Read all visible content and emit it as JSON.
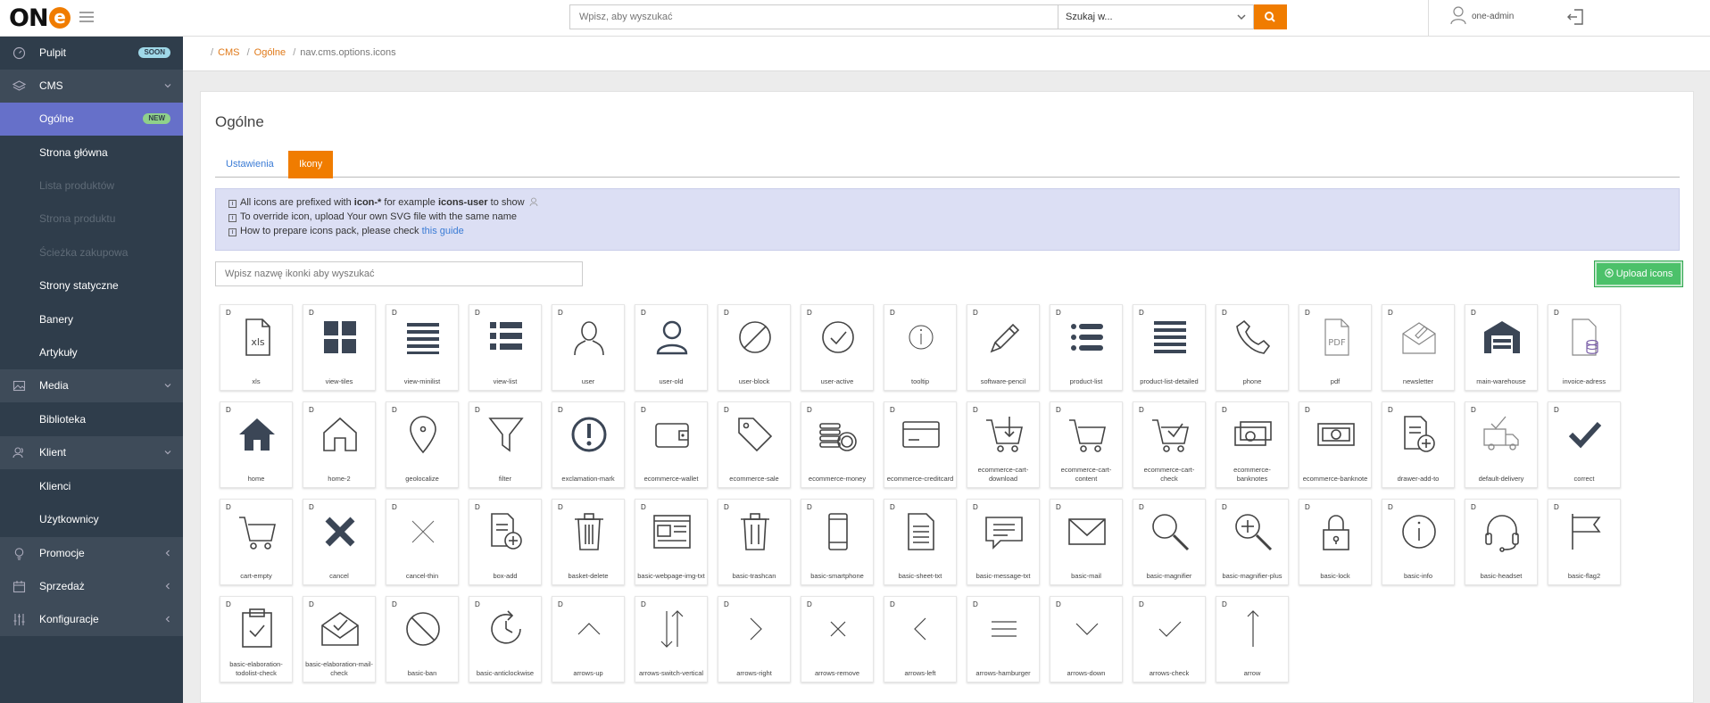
{
  "header": {
    "logo_text": "ON",
    "logo_e": "e",
    "search_placeholder": "Wpisz, aby wyszukać",
    "search_scope": "Szukaj w...",
    "user_name": "one-admin"
  },
  "sidebar": {
    "items": [
      {
        "label": "Pulpit",
        "badge": "SOON"
      },
      {
        "label": "CMS"
      },
      {
        "label": "Ogólne",
        "badge": "NEW"
      },
      {
        "label": "Strona główna"
      },
      {
        "label": "Lista produktów"
      },
      {
        "label": "Strona produktu"
      },
      {
        "label": "Ścieżka zakupowa"
      },
      {
        "label": "Strony statyczne"
      },
      {
        "label": "Banery"
      },
      {
        "label": "Artykuły"
      },
      {
        "label": "Media"
      },
      {
        "label": "Biblioteka"
      },
      {
        "label": "Klient"
      },
      {
        "label": "Klienci"
      },
      {
        "label": "Użytkownicy"
      },
      {
        "label": "Promocje"
      },
      {
        "label": "Sprzedaż"
      },
      {
        "label": "Konfiguracje"
      }
    ]
  },
  "breadcrumb": {
    "sep": "/",
    "items": [
      "CMS",
      "Ogólne",
      "nav.cms.options.icons"
    ]
  },
  "page": {
    "title": "Ogólne",
    "tabs": [
      "Ustawienia",
      "Ikony"
    ],
    "info": {
      "line1_a": "All icons are prefixed with ",
      "line1_b": "icon-*",
      "line1_c": " for example ",
      "line1_d": "icons-user",
      "line1_e": " to show",
      "line2": "To override icon, upload Your own SVG file with the same name",
      "line3_a": "How to prepare icons pack, please check ",
      "line3_link": "this guide",
      "info_glyph": "i"
    },
    "filter_placeholder": "Wpisz nazwę ikonki aby wyszukać",
    "upload_label": "Upload icons"
  },
  "icons": {
    "badge": "D",
    "names": [
      "xls",
      "view-tiles",
      "view-minilist",
      "view-list",
      "user",
      "user-old",
      "user-block",
      "user-active",
      "tooltip",
      "software-pencil",
      "product-list",
      "product-list-detailed",
      "phone",
      "pdf",
      "newsletter",
      "main-warehouse",
      "invoice-adress",
      "home",
      "home-2",
      "geolocalize",
      "filter",
      "exclamation-mark",
      "ecommerce-wallet",
      "ecommerce-sale",
      "ecommerce-money",
      "ecommerce-creditcard",
      "ecommerce-cart-download",
      "ecommerce-cart-content",
      "ecommerce-cart-check",
      "ecommerce-banknotes",
      "ecommerce-banknote",
      "drawer-add-to",
      "default-delivery",
      "correct",
      "cart-empty",
      "cancel",
      "cancel-thin",
      "box-add",
      "basket-delete",
      "basic-webpage-img-txt",
      "basic-trashcan",
      "basic-smartphone",
      "basic-sheet-txt",
      "basic-message-txt",
      "basic-mail",
      "basic-magnifier",
      "basic-magnifier-plus",
      "basic-lock",
      "basic-info",
      "basic-headset",
      "basic-flag2",
      "basic-elaboration-todolist-check",
      "basic-elaboration-mail-check",
      "basic-ban",
      "basic-anticlockwise",
      "arrows-up",
      "arrows-switch-vertical",
      "arrows-right",
      "arrows-remove",
      "arrows-left",
      "arrows-hamburger",
      "arrows-down",
      "arrows-check",
      "arrow"
    ],
    "xls_text": "xls",
    "pdf_text": "PDF"
  }
}
